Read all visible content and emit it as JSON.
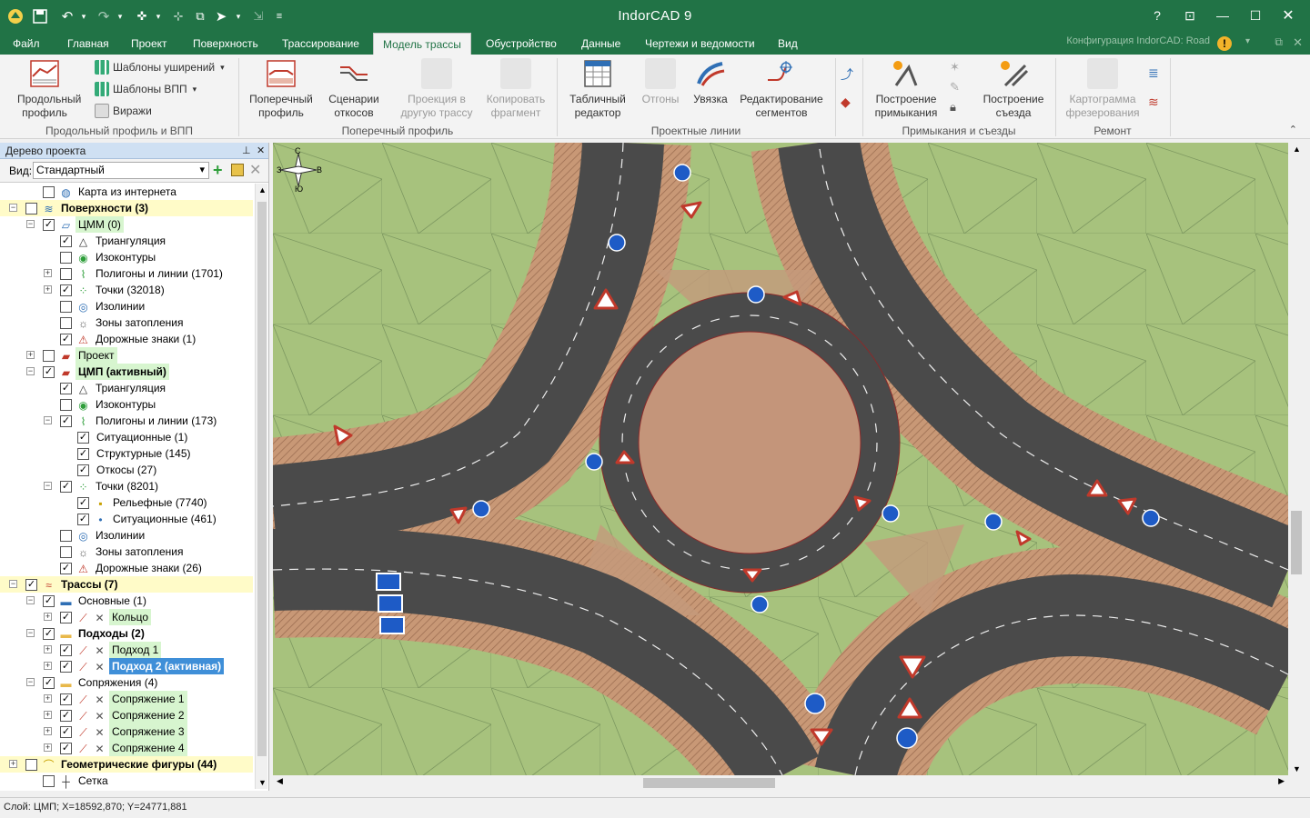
{
  "app": {
    "title": "IndorCAD 9",
    "config_label": "Конфигурация IndorCAD: Road"
  },
  "quick_access": [
    "app-logo-icon",
    "save-icon",
    "undo-icon",
    "redo-icon",
    "dropdown-icon",
    "snap-icon",
    "select-nodes-icon",
    "pointer-icon",
    "layers-icon",
    "customize-icon"
  ],
  "tabs": [
    {
      "label": "Файл"
    },
    {
      "label": "Главная"
    },
    {
      "label": "Проект"
    },
    {
      "label": "Поверхность"
    },
    {
      "label": "Трассирование"
    },
    {
      "label": "Модель трассы",
      "active": true
    },
    {
      "label": "Обустройство"
    },
    {
      "label": "Данные"
    },
    {
      "label": "Чертежи и ведомости"
    },
    {
      "label": "Вид"
    }
  ],
  "ribbon": {
    "long_profile": "Продольный профиль",
    "templates_wide": "Шаблоны уширений",
    "templates_vpp": "Шаблоны ВПП",
    "viraji": "Виражи",
    "group1": "Продольный профиль и ВПП",
    "cross_profile": "Поперечный профиль",
    "slope_scenarios": "Сценарии откосов",
    "projection": "Проекция в другую трассу",
    "copy_fragment": "Копировать фрагмент",
    "group2": "Поперечный профиль",
    "table_editor": "Табличный редактор",
    "otgony": "Отгоны",
    "uvyazka": "Увязка",
    "edit_segments": "Редактирование сегментов",
    "group3": "Проектные линии",
    "build_junction": "Построение примыкания",
    "build_exit": "Построение съезда",
    "group4": "Примыкания и съезды",
    "milling_map": "Картограмма фрезерования",
    "group5": "Ремонт"
  },
  "panel": {
    "title": "Дерево проекта",
    "view_label": "Вид:",
    "view_value": "Стандартный"
  },
  "tree": [
    {
      "d": 1,
      "exp": "",
      "cb": "",
      "icon": "globe-icon",
      "label": "Карта из интернета",
      "style": ""
    },
    {
      "d": 0,
      "exp": "-",
      "cb": "",
      "icon": "surfaces-icon",
      "label": "Поверхности (3)",
      "style": "yb"
    },
    {
      "d": 1,
      "exp": "-",
      "cb": "✓",
      "icon": "surface-icon",
      "label": "ЦММ (0)",
      "style": "g"
    },
    {
      "d": 2,
      "exp": "",
      "cb": "✓",
      "icon": "triangle-icon",
      "label": "Триангуляция",
      "style": ""
    },
    {
      "d": 2,
      "exp": "",
      "cb": "",
      "icon": "isolines-icon",
      "label": "Изоконтуры",
      "style": ""
    },
    {
      "d": 2,
      "exp": "+",
      "cb": "",
      "icon": "polygon-icon",
      "label": "Полигоны и линии (1701)",
      "style": ""
    },
    {
      "d": 2,
      "exp": "+",
      "cb": "✓",
      "icon": "points-icon",
      "label": "Точки (32018)",
      "style": ""
    },
    {
      "d": 2,
      "exp": "",
      "cb": "",
      "icon": "contour-icon",
      "label": "Изолинии",
      "style": ""
    },
    {
      "d": 2,
      "exp": "",
      "cb": "",
      "icon": "flood-icon",
      "label": "Зоны затопления",
      "style": ""
    },
    {
      "d": 2,
      "exp": "",
      "cb": "✓",
      "icon": "road-sign-icon",
      "label": "Дорожные знаки (1)",
      "style": ""
    },
    {
      "d": 1,
      "exp": "+",
      "cb": "",
      "icon": "project-icon",
      "label": "Проект",
      "style": "g"
    },
    {
      "d": 1,
      "exp": "-",
      "cb": "✓",
      "icon": "project-icon",
      "label": "ЦМП (активный)",
      "style": "gb"
    },
    {
      "d": 2,
      "exp": "",
      "cb": "✓",
      "icon": "triangle-icon",
      "label": "Триангуляция",
      "style": ""
    },
    {
      "d": 2,
      "exp": "",
      "cb": "",
      "icon": "isolines-icon",
      "label": "Изоконтуры",
      "style": ""
    },
    {
      "d": 2,
      "exp": "-",
      "cb": "✓",
      "icon": "polygon-icon",
      "label": "Полигоны и линии (173)",
      "style": ""
    },
    {
      "d": 3,
      "exp": "",
      "cb": "✓",
      "icon": "",
      "label": "Ситуационные (1)",
      "style": ""
    },
    {
      "d": 3,
      "exp": "",
      "cb": "✓",
      "icon": "",
      "label": "Структурные (145)",
      "style": ""
    },
    {
      "d": 3,
      "exp": "",
      "cb": "✓",
      "icon": "",
      "label": "Откосы (27)",
      "style": ""
    },
    {
      "d": 2,
      "exp": "-",
      "cb": "✓",
      "icon": "points-icon",
      "label": "Точки (8201)",
      "style": ""
    },
    {
      "d": 3,
      "exp": "",
      "cb": "✓",
      "icon": "relief-points-icon",
      "label": "Рельефные (7740)",
      "style": ""
    },
    {
      "d": 3,
      "exp": "",
      "cb": "✓",
      "icon": "dot-icon",
      "label": "Ситуационные (461)",
      "style": ""
    },
    {
      "d": 2,
      "exp": "",
      "cb": "",
      "icon": "contour-icon",
      "label": "Изолинии",
      "style": ""
    },
    {
      "d": 2,
      "exp": "",
      "cb": "",
      "icon": "flood-icon",
      "label": "Зоны затопления",
      "style": ""
    },
    {
      "d": 2,
      "exp": "",
      "cb": "✓",
      "icon": "road-sign-icon",
      "label": "Дорожные знаки (26)",
      "style": ""
    },
    {
      "d": 0,
      "exp": "-",
      "cb": "✓",
      "icon": "routes-icon",
      "label": "Трассы (7)",
      "style": "yb"
    },
    {
      "d": 1,
      "exp": "-",
      "cb": "✓",
      "icon": "folder-blue-icon",
      "label": "Основные (1)",
      "style": ""
    },
    {
      "d": 2,
      "exp": "+",
      "cb": "✓",
      "icon": "route-icon",
      "label": "Кольцо",
      "style": "g"
    },
    {
      "d": 1,
      "exp": "-",
      "cb": "✓",
      "icon": "folder-icon",
      "label": "Подходы (2)",
      "style": "b"
    },
    {
      "d": 2,
      "exp": "+",
      "cb": "✓",
      "icon": "route-icon",
      "label": "Подход 1",
      "style": "g"
    },
    {
      "d": 2,
      "exp": "+",
      "cb": "✓",
      "icon": "route-icon",
      "label": "Подход 2 (активная)",
      "style": "sel"
    },
    {
      "d": 1,
      "exp": "-",
      "cb": "✓",
      "icon": "folder-icon",
      "label": "Сопряжения (4)",
      "style": ""
    },
    {
      "d": 2,
      "exp": "+",
      "cb": "✓",
      "icon": "route-icon",
      "label": "Сопряжение 1",
      "style": "g"
    },
    {
      "d": 2,
      "exp": "+",
      "cb": "✓",
      "icon": "route-icon",
      "label": "Сопряжение 2",
      "style": "g"
    },
    {
      "d": 2,
      "exp": "+",
      "cb": "✓",
      "icon": "route-icon",
      "label": "Сопряжение 3",
      "style": "g"
    },
    {
      "d": 2,
      "exp": "+",
      "cb": "✓",
      "icon": "route-icon",
      "label": "Сопряжение 4",
      "style": "g"
    },
    {
      "d": 0,
      "exp": "+",
      "cb": "",
      "icon": "geometry-icon",
      "label": "Геометрические фигуры (44)",
      "style": "yb"
    },
    {
      "d": 1,
      "exp": "",
      "cb": "",
      "icon": "grid-icon",
      "label": "Сетка",
      "style": ""
    }
  ],
  "compass": {
    "n": "С",
    "s": "Ю",
    "w": "З",
    "e": "В"
  },
  "status": {
    "text": "Слой: ЦМП; X=18592,870; Y=24771,881"
  }
}
